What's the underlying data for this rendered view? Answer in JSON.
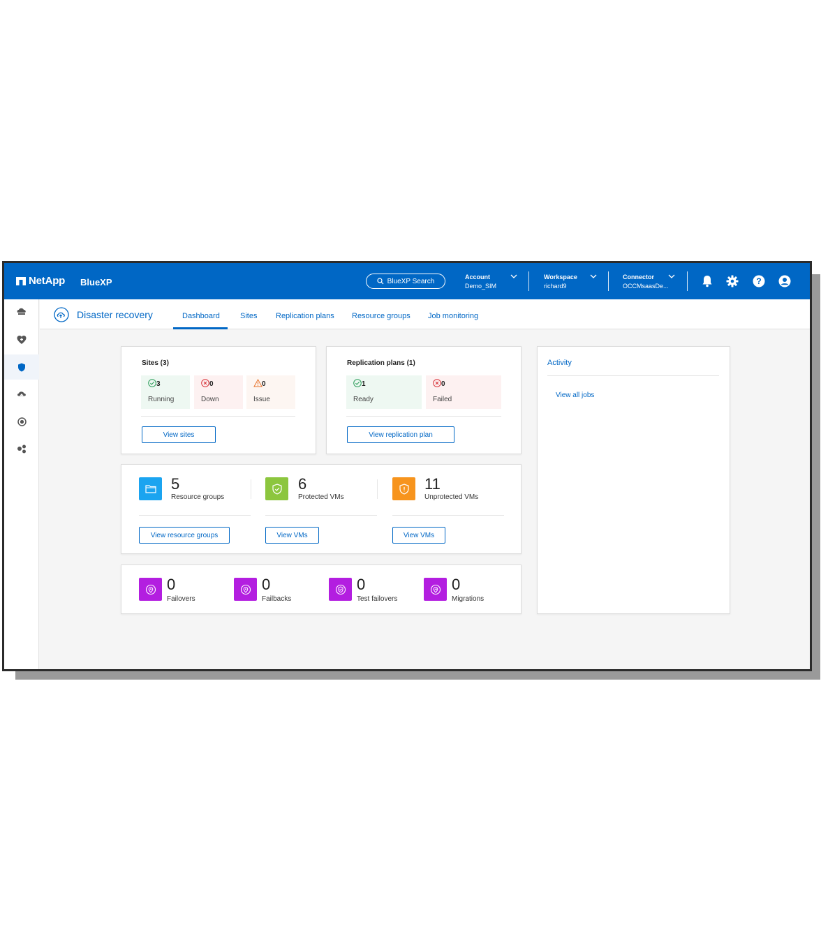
{
  "topbar": {
    "brand": "NetApp",
    "product": "BlueXP",
    "search_label": "BlueXP Search",
    "account": {
      "label": "Account",
      "value": "Demo_SIM"
    },
    "workspace": {
      "label": "Workspace",
      "value": "richard9"
    },
    "connector": {
      "label": "Connector",
      "value": "OCCMsaasDe..."
    },
    "icons": [
      "bell-icon",
      "gear-icon",
      "help-icon",
      "user-icon"
    ]
  },
  "rail": {
    "items": [
      "storage-icon",
      "health-icon",
      "protection-icon",
      "cloud-icon",
      "governance-icon",
      "mobility-icon"
    ],
    "active_index": 2
  },
  "header": {
    "title": "Disaster recovery",
    "tabs": [
      "Dashboard",
      "Sites",
      "Replication plans",
      "Resource groups",
      "Job monitoring"
    ],
    "active_tab": "Dashboard"
  },
  "sites": {
    "title": "Sites (3)",
    "tiles": [
      {
        "count": "3",
        "label": "Running"
      },
      {
        "count": "0",
        "label": "Down"
      },
      {
        "count": "0",
        "label": "Issue"
      }
    ],
    "button": "View sites"
  },
  "replication": {
    "title": "Replication plans (1)",
    "tiles": [
      {
        "count": "1",
        "label": "Ready"
      },
      {
        "count": "0",
        "label": "Failed"
      }
    ],
    "button": "View replication plan"
  },
  "metrics": [
    {
      "value": "5",
      "label": "Resource groups",
      "button": "View resource groups",
      "color": "#1ba4f0"
    },
    {
      "value": "6",
      "label": "Protected VMs",
      "button": "View VMs",
      "color": "#8cc63e"
    },
    {
      "value": "11",
      "label": "Unprotected VMs",
      "button": "View VMs",
      "color": "#f7941d"
    }
  ],
  "operations": [
    {
      "value": "0",
      "label": "Failovers"
    },
    {
      "value": "0",
      "label": "Failbacks"
    },
    {
      "value": "0",
      "label": "Test failovers"
    },
    {
      "value": "0",
      "label": "Migrations"
    }
  ],
  "activity": {
    "title": "Activity",
    "link": "View all jobs"
  },
  "colors": {
    "brand_blue": "#0067c5",
    "ops_purple": "#b31ee0",
    "running_bg": "#eef8f2",
    "down_bg": "#fdf1f1",
    "issue_bg": "#fdf6f2"
  }
}
